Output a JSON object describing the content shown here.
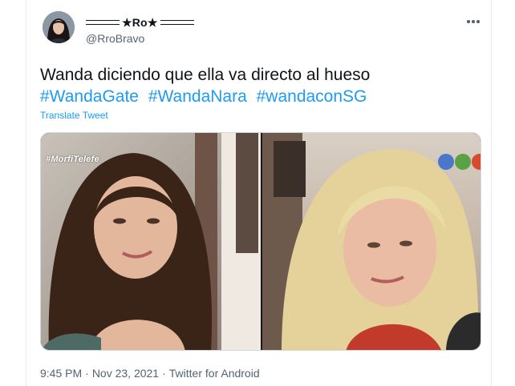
{
  "tweet": {
    "display_name": "★Ro★",
    "handle": "@RroBravo",
    "text_line1": "Wanda diciendo que ella va directo al hueso",
    "hashtags": [
      "#WandaGate",
      "#WandaNara",
      "#wandaconSG"
    ],
    "translate_label": "Translate Tweet",
    "time": "9:45 PM",
    "date": "Nov 23, 2021",
    "source": "Twitter for Android",
    "separator": "·"
  },
  "media": {
    "watermark": "#MorfiTelefe"
  },
  "icons": {
    "more": "more-horizontal-icon",
    "avatar": "profile-avatar"
  },
  "colors": {
    "link": "#1d9bf0",
    "text": "#0f1419",
    "secondary": "#536471"
  }
}
